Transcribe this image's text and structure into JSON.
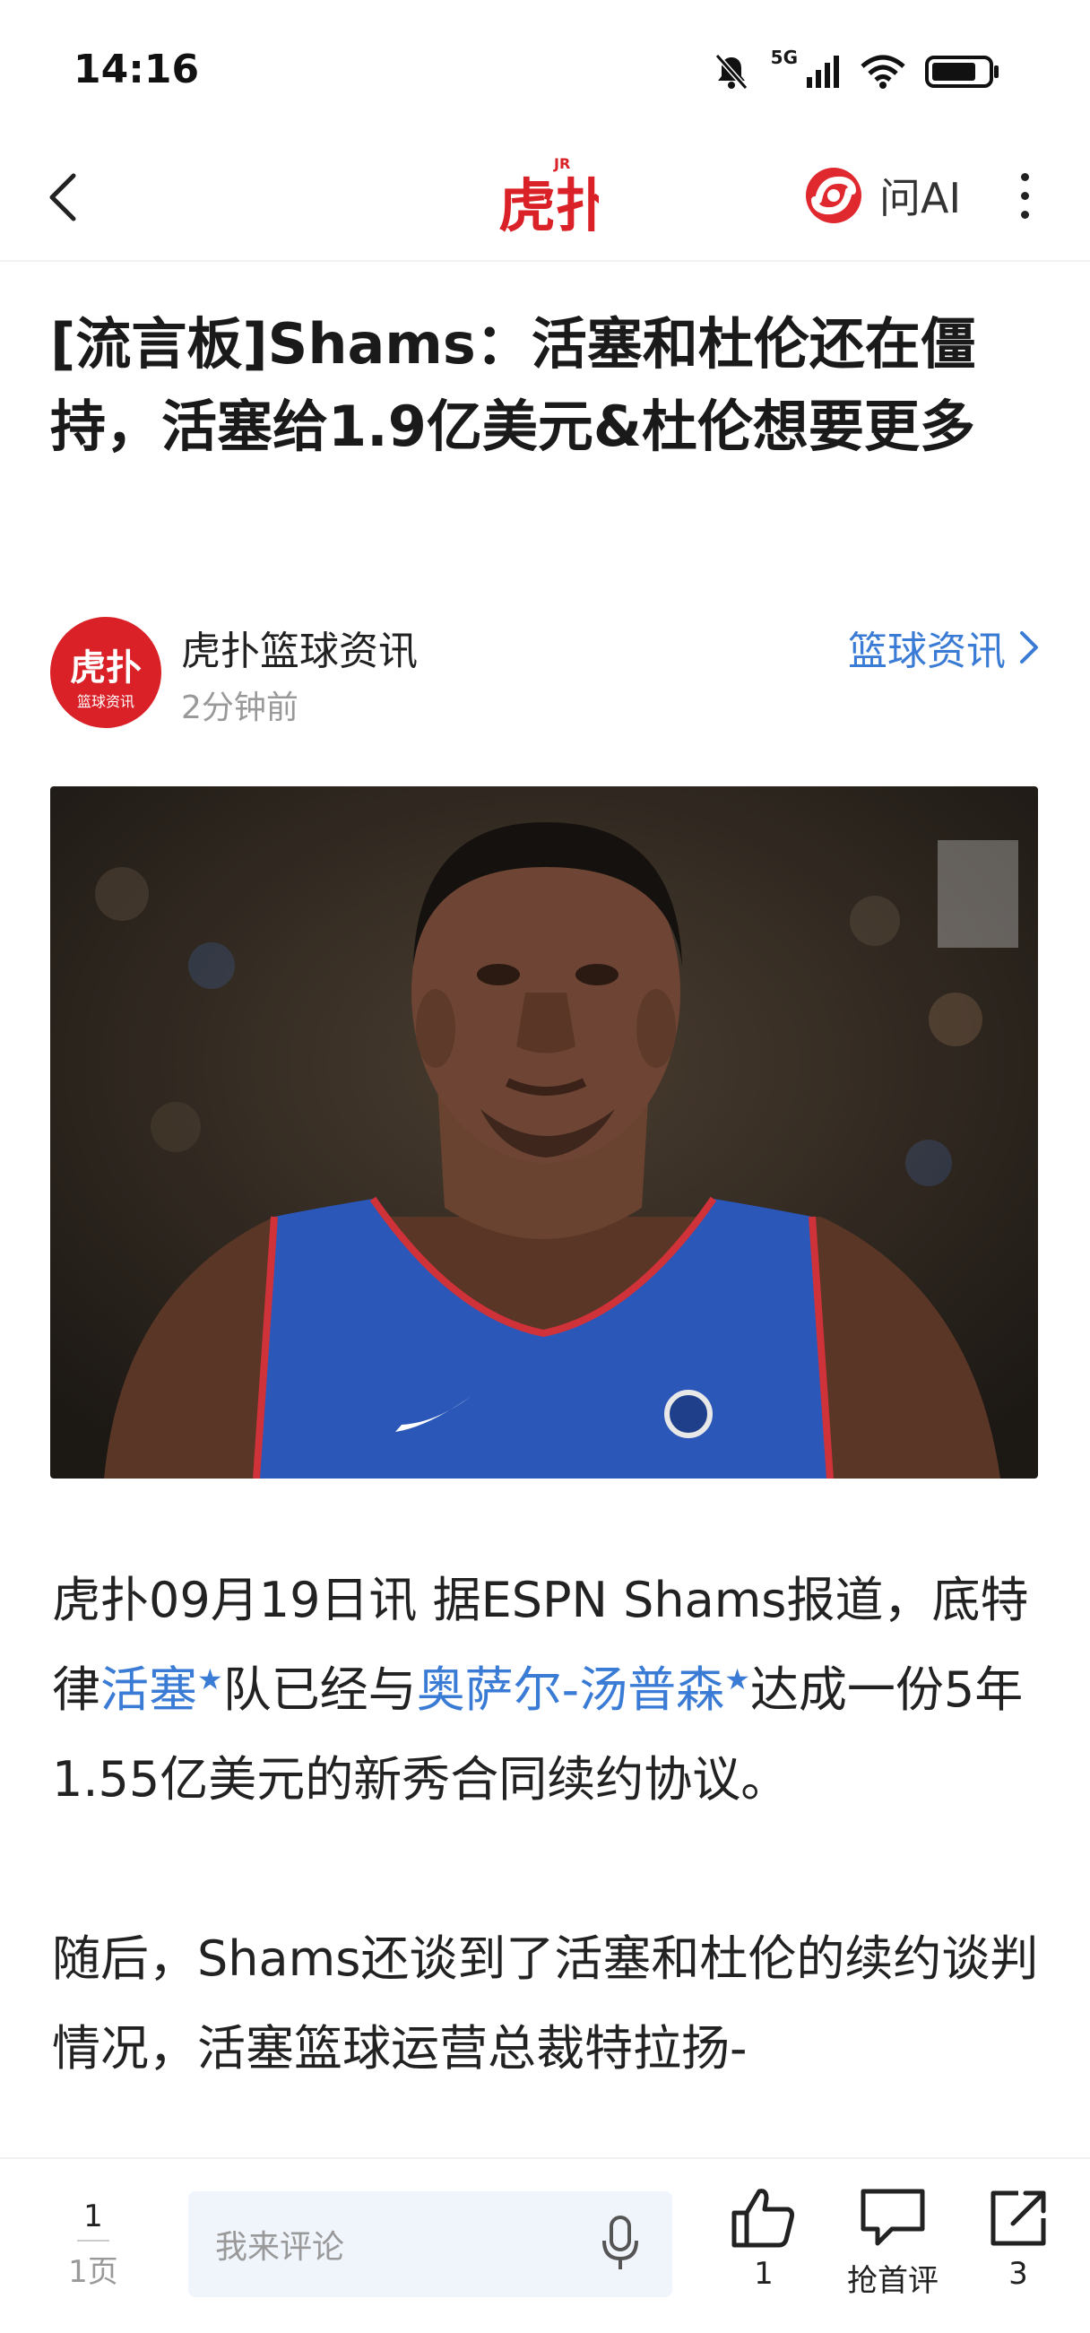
{
  "status_bar": {
    "time": "14:16",
    "network": "5G"
  },
  "nav": {
    "logo_text": "虎扑",
    "logo_badge": "JR",
    "ai_label": "问AI"
  },
  "article": {
    "title": "[流言板]Shams：活塞和杜伦还在僵持，活塞给1.9亿美元&杜伦想要更多",
    "author": {
      "name": "虎扑篮球资讯",
      "avatar_text_top": "虎扑",
      "avatar_text_bottom": "篮球资讯",
      "time": "2分钟前"
    },
    "category": "篮球资讯",
    "image": {
      "jersey_color": "#2b57b8",
      "trim_color": "#d0323a",
      "background": "#2b2520"
    },
    "paragraphs": [
      {
        "parts": [
          {
            "text": "虎扑09月19日讯 据ESPN Shams报道，底特律",
            "link": false
          },
          {
            "text": "活塞",
            "link": true
          },
          {
            "text": "队已经与",
            "link": false
          },
          {
            "text": "奥萨尔-汤普森",
            "link": true
          },
          {
            "text": "达成一份5年1.55亿美元的新秀合同续约协议。",
            "link": false
          }
        ]
      },
      {
        "parts": [
          {
            "text": "随后，Shams还谈到了活塞和杜伦的续约谈判情况，活塞篮球运营总裁特拉扬-",
            "link": false
          }
        ]
      }
    ]
  },
  "bottom_bar": {
    "page_current": "1",
    "page_total": "1页",
    "comment_placeholder": "我来评论",
    "like_count": "1",
    "comment_label": "抢首评",
    "share_count": "3"
  },
  "colors": {
    "accent": "#3a7bd5",
    "brand_red": "#d92127"
  }
}
